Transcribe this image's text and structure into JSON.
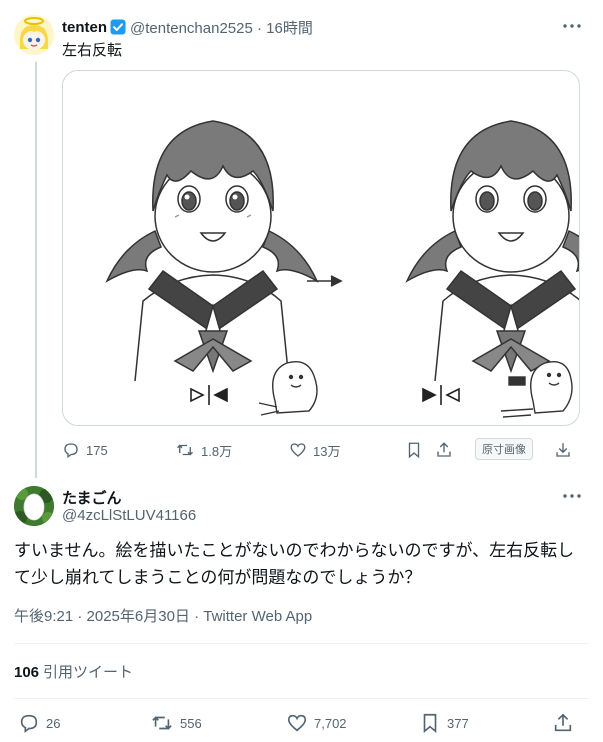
{
  "parent": {
    "name": "tenten",
    "handle_time": "@tentenchan2525 · 16時間",
    "text": "左右反転",
    "stats": {
      "replies": "175",
      "retweets": "1.8万",
      "likes": "13万"
    },
    "alt_label": "原寸画像"
  },
  "reply": {
    "name": "たまごん",
    "handle": "@4zcLlStLUV41166",
    "text": "すいません。絵を描いたことがないのでわからないのですが、左右反転して少し崩れてしまうことの何が問題なのでしょうか？",
    "meta": "午後9:21 · 2025年6月30日 · Twitter Web App",
    "quote_count": "106",
    "quote_label": "引用ツイート",
    "stats": {
      "replies": "26",
      "retweets": "556",
      "likes": "7,702",
      "bookmarks": "377"
    }
  },
  "colors": {
    "text": "#0f1419",
    "secondary": "#536471",
    "border": "#cfd9de",
    "verified_blue": "#1d9bf0"
  },
  "icons": [
    "more-icon",
    "verified-icon",
    "reply-icon",
    "retweet-icon",
    "like-icon",
    "bookmark-icon",
    "share-icon",
    "download-icon",
    "flip-icon"
  ]
}
